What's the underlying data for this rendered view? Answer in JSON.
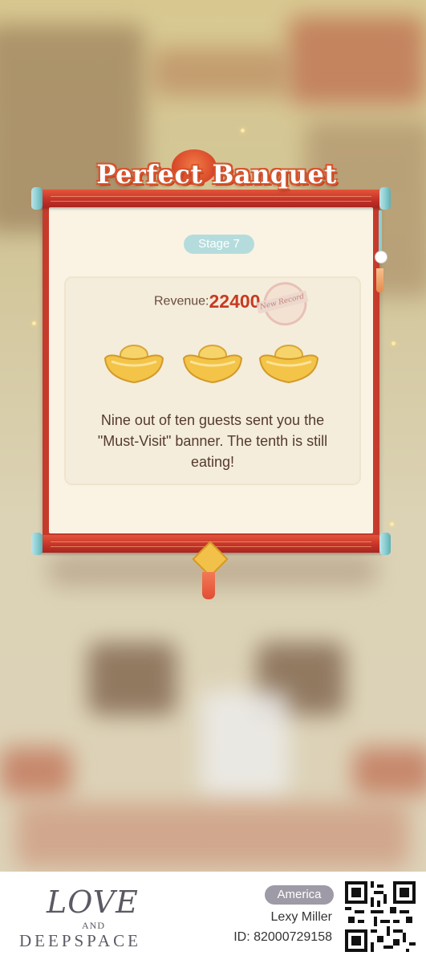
{
  "result_panel": {
    "title": "Perfect Banquet",
    "stage_label": "Stage 7",
    "revenue_label": "Revenue:",
    "revenue_value": "22400",
    "record_stamp": "New Record",
    "ingot_count": 3,
    "message": "Nine out of ten guests sent you the \"Must-Visit\" banner. The tenth is still eating!"
  },
  "footer": {
    "logo_line1": "LOVE",
    "logo_line2": "AND",
    "logo_line3": "DEEPSPACE",
    "region": "America",
    "player_name": "Lexy Miller",
    "player_id": "ID: 82000729158"
  },
  "colors": {
    "scroll_red": "#c63a2c",
    "paper": "#faf3e4",
    "revenue_red": "#c83a22",
    "stage_pill": "#b5dcdd",
    "gold": "#f2c14a"
  }
}
